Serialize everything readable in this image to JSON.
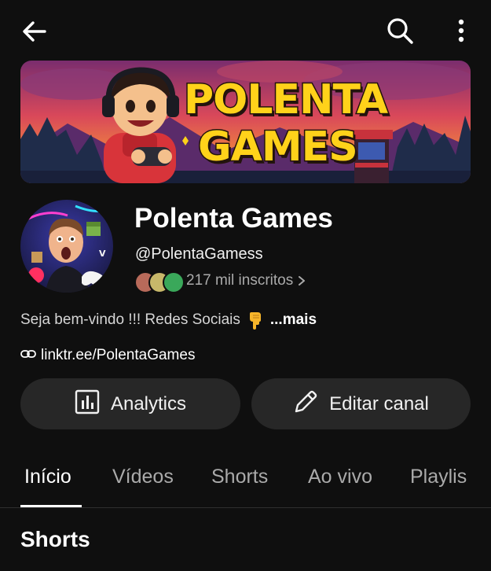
{
  "channel": {
    "name": "Polenta Games",
    "handle": "@PolentaGamess",
    "subscribers": "217 mil inscritos",
    "description": "Seja bem-vindo !!! Redes Sociais",
    "description_more": "...mais",
    "link": "linktr.ee/PolentaGames"
  },
  "banner": {
    "line1": "POLENTA",
    "line2": "GAMES"
  },
  "actions": {
    "analytics_label": "Analytics",
    "edit_label": "Editar canal"
  },
  "tabs": [
    {
      "label": "Início",
      "active": true
    },
    {
      "label": "Vídeos",
      "active": false
    },
    {
      "label": "Shorts",
      "active": false
    },
    {
      "label": "Ao vivo",
      "active": false
    },
    {
      "label": "Playlis",
      "active": false
    }
  ],
  "section": {
    "title": "Shorts"
  },
  "icons": {
    "back": "back-arrow-icon",
    "search": "search-icon",
    "more": "more-vertical-icon",
    "analytics": "bar-chart-icon",
    "edit": "pencil-icon",
    "link": "link-icon",
    "chevron": "chevron-right-icon",
    "emoji": "pointing-down-hand-icon"
  },
  "colors": {
    "background": "#0f0f0f",
    "button_bg": "#272727",
    "secondary_text": "#aaaaaa",
    "banner_text": "#ffd21a"
  }
}
